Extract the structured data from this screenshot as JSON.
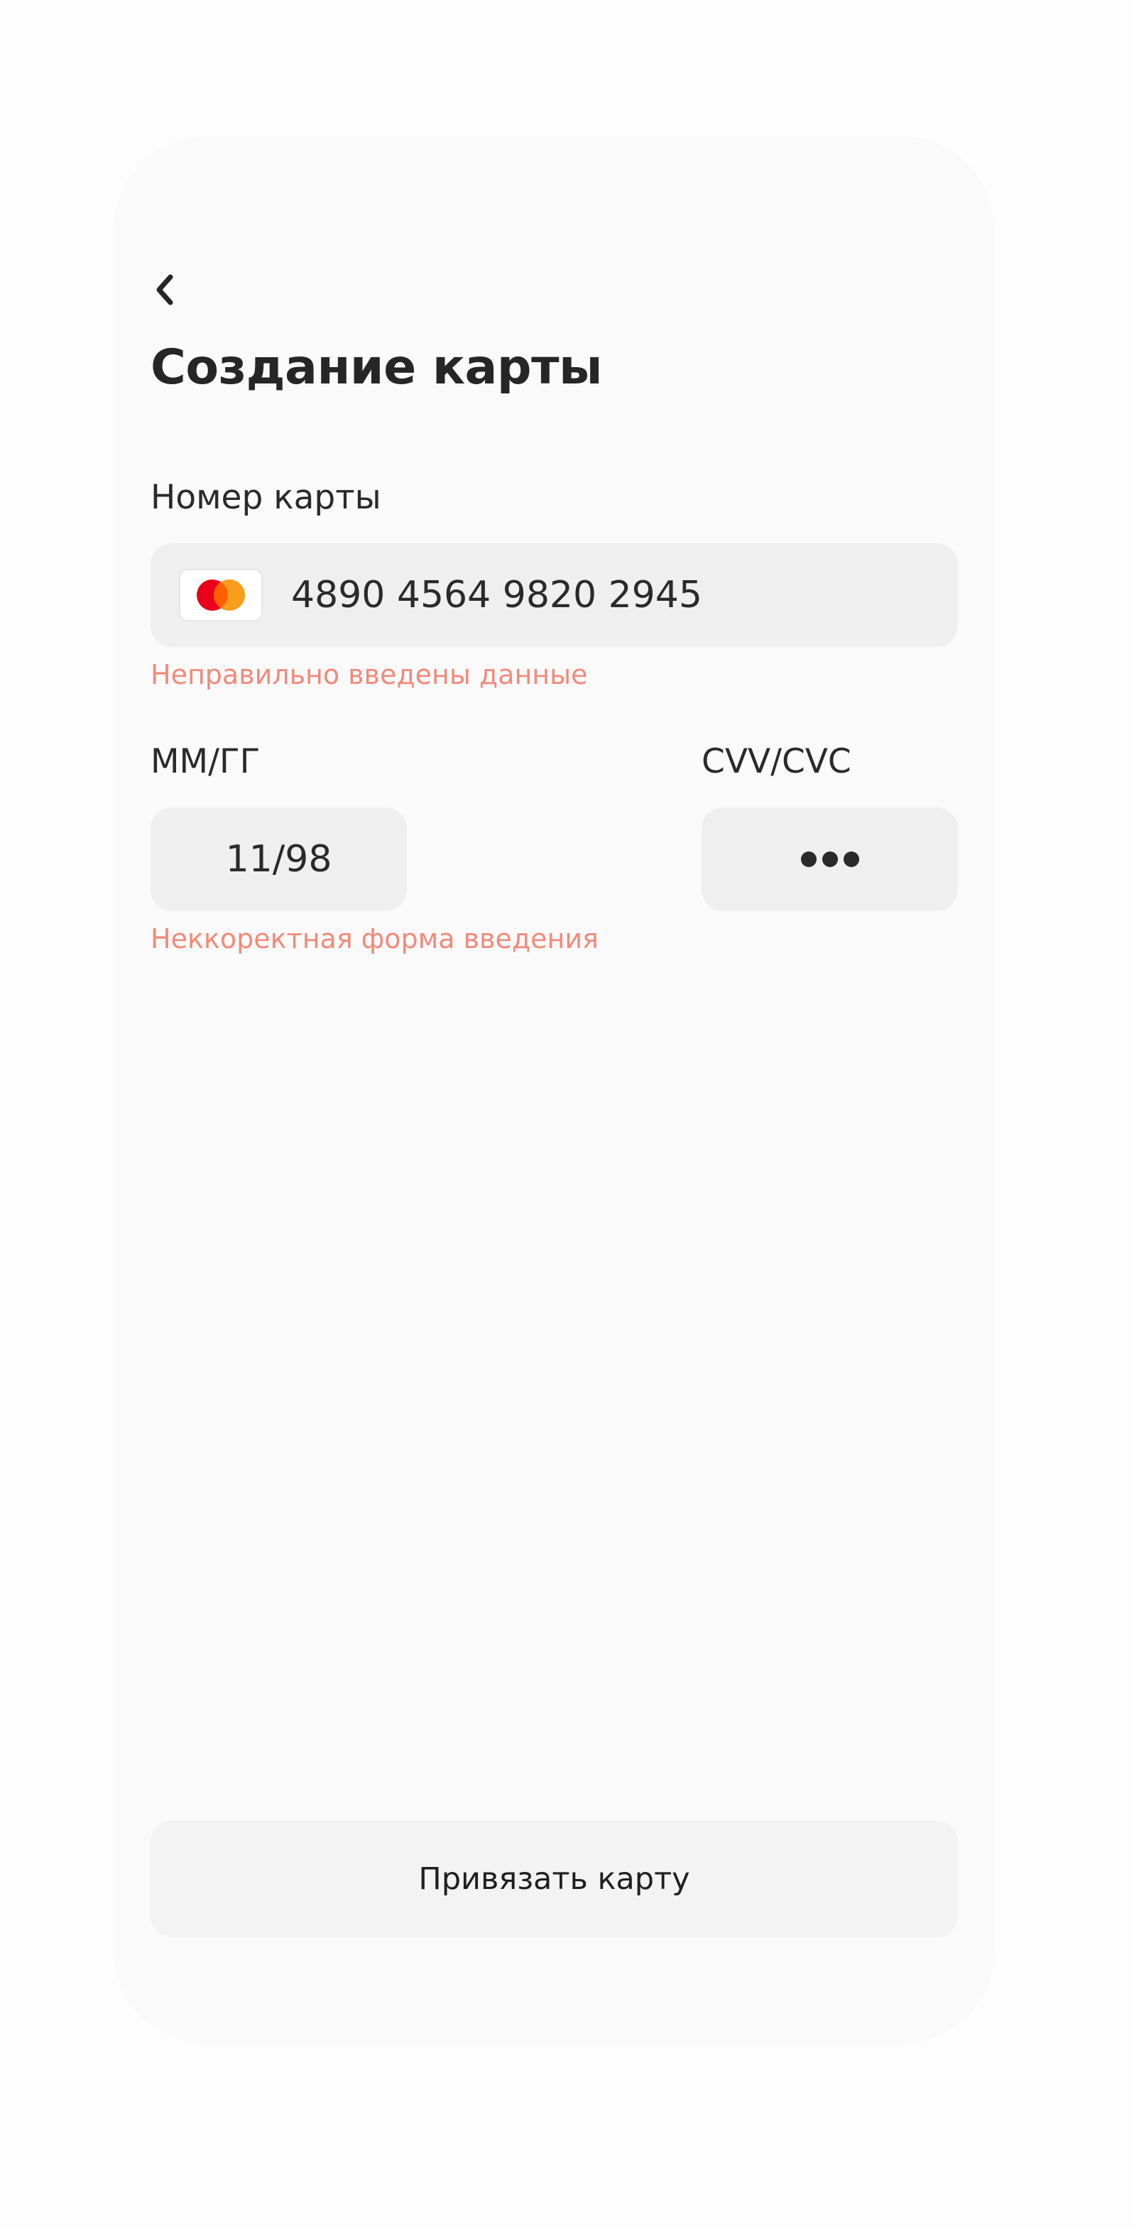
{
  "header": {
    "back_icon": "chevron-left-icon",
    "title": "Создание карты"
  },
  "card_number": {
    "label": "Номер карты",
    "value": "4890 4564 9820 2945",
    "brand_icon": "mastercard-logo-icon",
    "error": "Неправильно введены данные"
  },
  "expiry": {
    "label": "ММ/ГГ",
    "value": "11/98",
    "error": "Неккоректная форма введения"
  },
  "cvv": {
    "label": "CVV/CVC",
    "masked_digits": 3
  },
  "submit": {
    "label": "Привязать карту"
  },
  "colors": {
    "error": "#f28a7a",
    "input_background": "#efefef",
    "card_background": "#fafafa",
    "mastercard_red": "#eb001b",
    "mastercard_orange": "#f79e1b"
  }
}
